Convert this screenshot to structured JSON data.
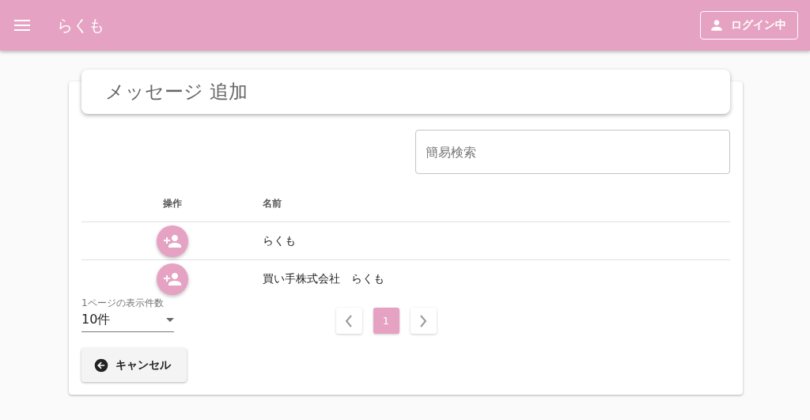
{
  "app_bar": {
    "title": "らくも",
    "login_button": "ログイン中"
  },
  "card": {
    "title": "メッセージ 追加",
    "search": {
      "placeholder": "簡易検索"
    },
    "table": {
      "columns": [
        "操作",
        "名前"
      ],
      "rows": [
        {
          "name": "らくも"
        },
        {
          "name": "買い手株式会社　らくも"
        }
      ]
    },
    "page_size": {
      "label": "1ページの表示件数",
      "value": "10件"
    },
    "pagination": {
      "pages": [
        {
          "label": "1",
          "selected": true
        }
      ]
    },
    "cancel_button": "キャンセル"
  }
}
